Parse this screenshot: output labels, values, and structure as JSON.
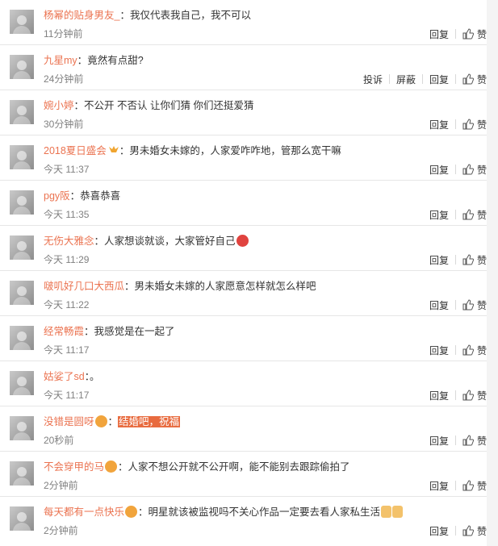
{
  "comments": [
    {
      "name": "杨幂的贴身男友_",
      "text": "我仅代表我自己，我不可以",
      "time": "11分钟前",
      "reply": "回复",
      "like": "赞"
    },
    {
      "name": "九星my",
      "text": "竟然有点甜?",
      "time": "24分钟前",
      "report": "投诉",
      "block": "屏蔽",
      "reply": "回复",
      "like": "赞"
    },
    {
      "name": "婉小婷",
      "text": "不公开 不否认 让你们猜 你们还挺爱猜",
      "time": "30分钟前",
      "reply": "回复",
      "like": "赞"
    },
    {
      "name": "2018夏日盛会",
      "text": "男未婚女未嫁的，人家爱咋咋地，管那么宽干嘛",
      "time": "今天 11:37",
      "reply": "回复",
      "like": "赞"
    },
    {
      "name": "pgy阪",
      "text": "恭喜恭喜",
      "time": "今天 11:35",
      "reply": "回复",
      "like": "赞"
    },
    {
      "name": "无伤大雅念",
      "text": "人家想谈就谈，大家管好自己",
      "time": "今天 11:29",
      "reply": "回复",
      "like": "赞"
    },
    {
      "name": "啵叽好几口大西瓜",
      "text": "男未婚女未嫁的人家愿意怎样就怎么样吧",
      "time": "今天 11:22",
      "reply": "回复",
      "like": "赞"
    },
    {
      "name": "经常畅霞",
      "text": "我感觉是在一起了",
      "time": "今天 11:17",
      "reply": "回复",
      "like": "赞"
    },
    {
      "name": "姑娑了sd",
      "text": "。",
      "time": "今天 11:17",
      "reply": "回复",
      "like": "赞"
    },
    {
      "name": "没错是圆呀",
      "text": "结婚吧，祝福",
      "time": "20秒前",
      "reply": "回复",
      "like": "赞"
    },
    {
      "name": "不会穿甲的马",
      "text": "人家不想公开就不公开啊，能不能别去跟踪偷拍了",
      "time": "2分钟前",
      "reply": "回复",
      "like": "赞"
    },
    {
      "name": "每天都有一点快乐",
      "text": "明星就该被监视吗不关心作品一定要去看人家私生活",
      "time": "2分钟前",
      "reply": "回复",
      "like": "赞"
    }
  ],
  "colors": {
    "name": "#eb7350",
    "time": "#808080",
    "text": "#333333",
    "divider": "#e6e6e6",
    "badge_gold": "#f0a530"
  },
  "icons": {
    "like": "thumbs-up-icon",
    "badge": "vip-badge-icon",
    "emoji": "emoji-icon"
  }
}
